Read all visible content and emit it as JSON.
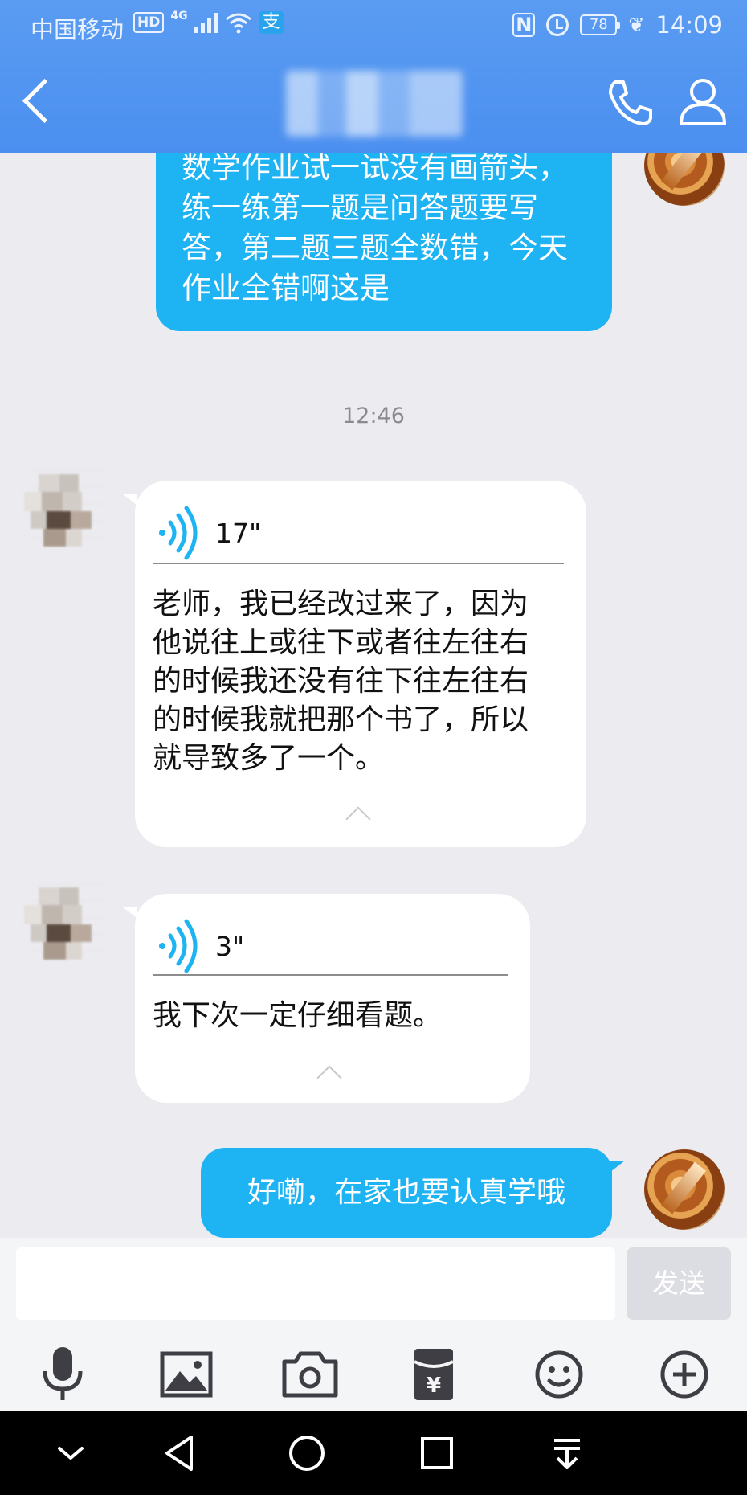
{
  "status_bar": {
    "carrier": "中国移动",
    "hd_badge": "HD",
    "network": "4G",
    "pay_icon": "支",
    "nfc_label": "N",
    "battery_level": "78",
    "time": "14:09"
  },
  "header": {
    "back_icon": "chevron-left-icon",
    "contact_name": "",
    "call_icon": "phone-icon",
    "profile_icon": "person-icon",
    "background_color": "#4b8ff0"
  },
  "messages": [
    {
      "sender": "me",
      "type": "text",
      "text": "数学作业试一试没有画箭头，练一练第一题是问答题要写答，第二题三题全数错，今天作业全错啊这是"
    },
    {
      "type": "timestamp",
      "text": "12:46"
    },
    {
      "sender": "other",
      "type": "voice",
      "duration": "17\"",
      "transcript": "老师，我已经改过来了，因为他说往上或往下或者往左往右的时候我还没有往下往左往右的时候我就把那个书了，所以就导致多了一个。"
    },
    {
      "sender": "other",
      "type": "voice",
      "duration": "3\"",
      "transcript": "我下次一定仔细看题。"
    },
    {
      "sender": "me",
      "type": "text",
      "text": "好嘞，在家也要认真学哦"
    }
  ],
  "input": {
    "value": "",
    "placeholder": "",
    "send_label": "发送"
  },
  "toolbar": {
    "items": [
      "microphone-icon",
      "image-icon",
      "camera-icon",
      "red-packet-icon",
      "emoji-icon",
      "plus-icon"
    ]
  },
  "nav_bar": {
    "items": [
      "hide-keyboard-icon",
      "back-triangle-icon",
      "home-circle-icon",
      "recents-square-icon",
      "notification-pull-icon"
    ]
  },
  "colors": {
    "outgoing_bubble": "#1eb3f3",
    "incoming_bubble": "#ffffff",
    "chat_background": "#ececf0",
    "voice_wave": "#1eb3f3"
  }
}
